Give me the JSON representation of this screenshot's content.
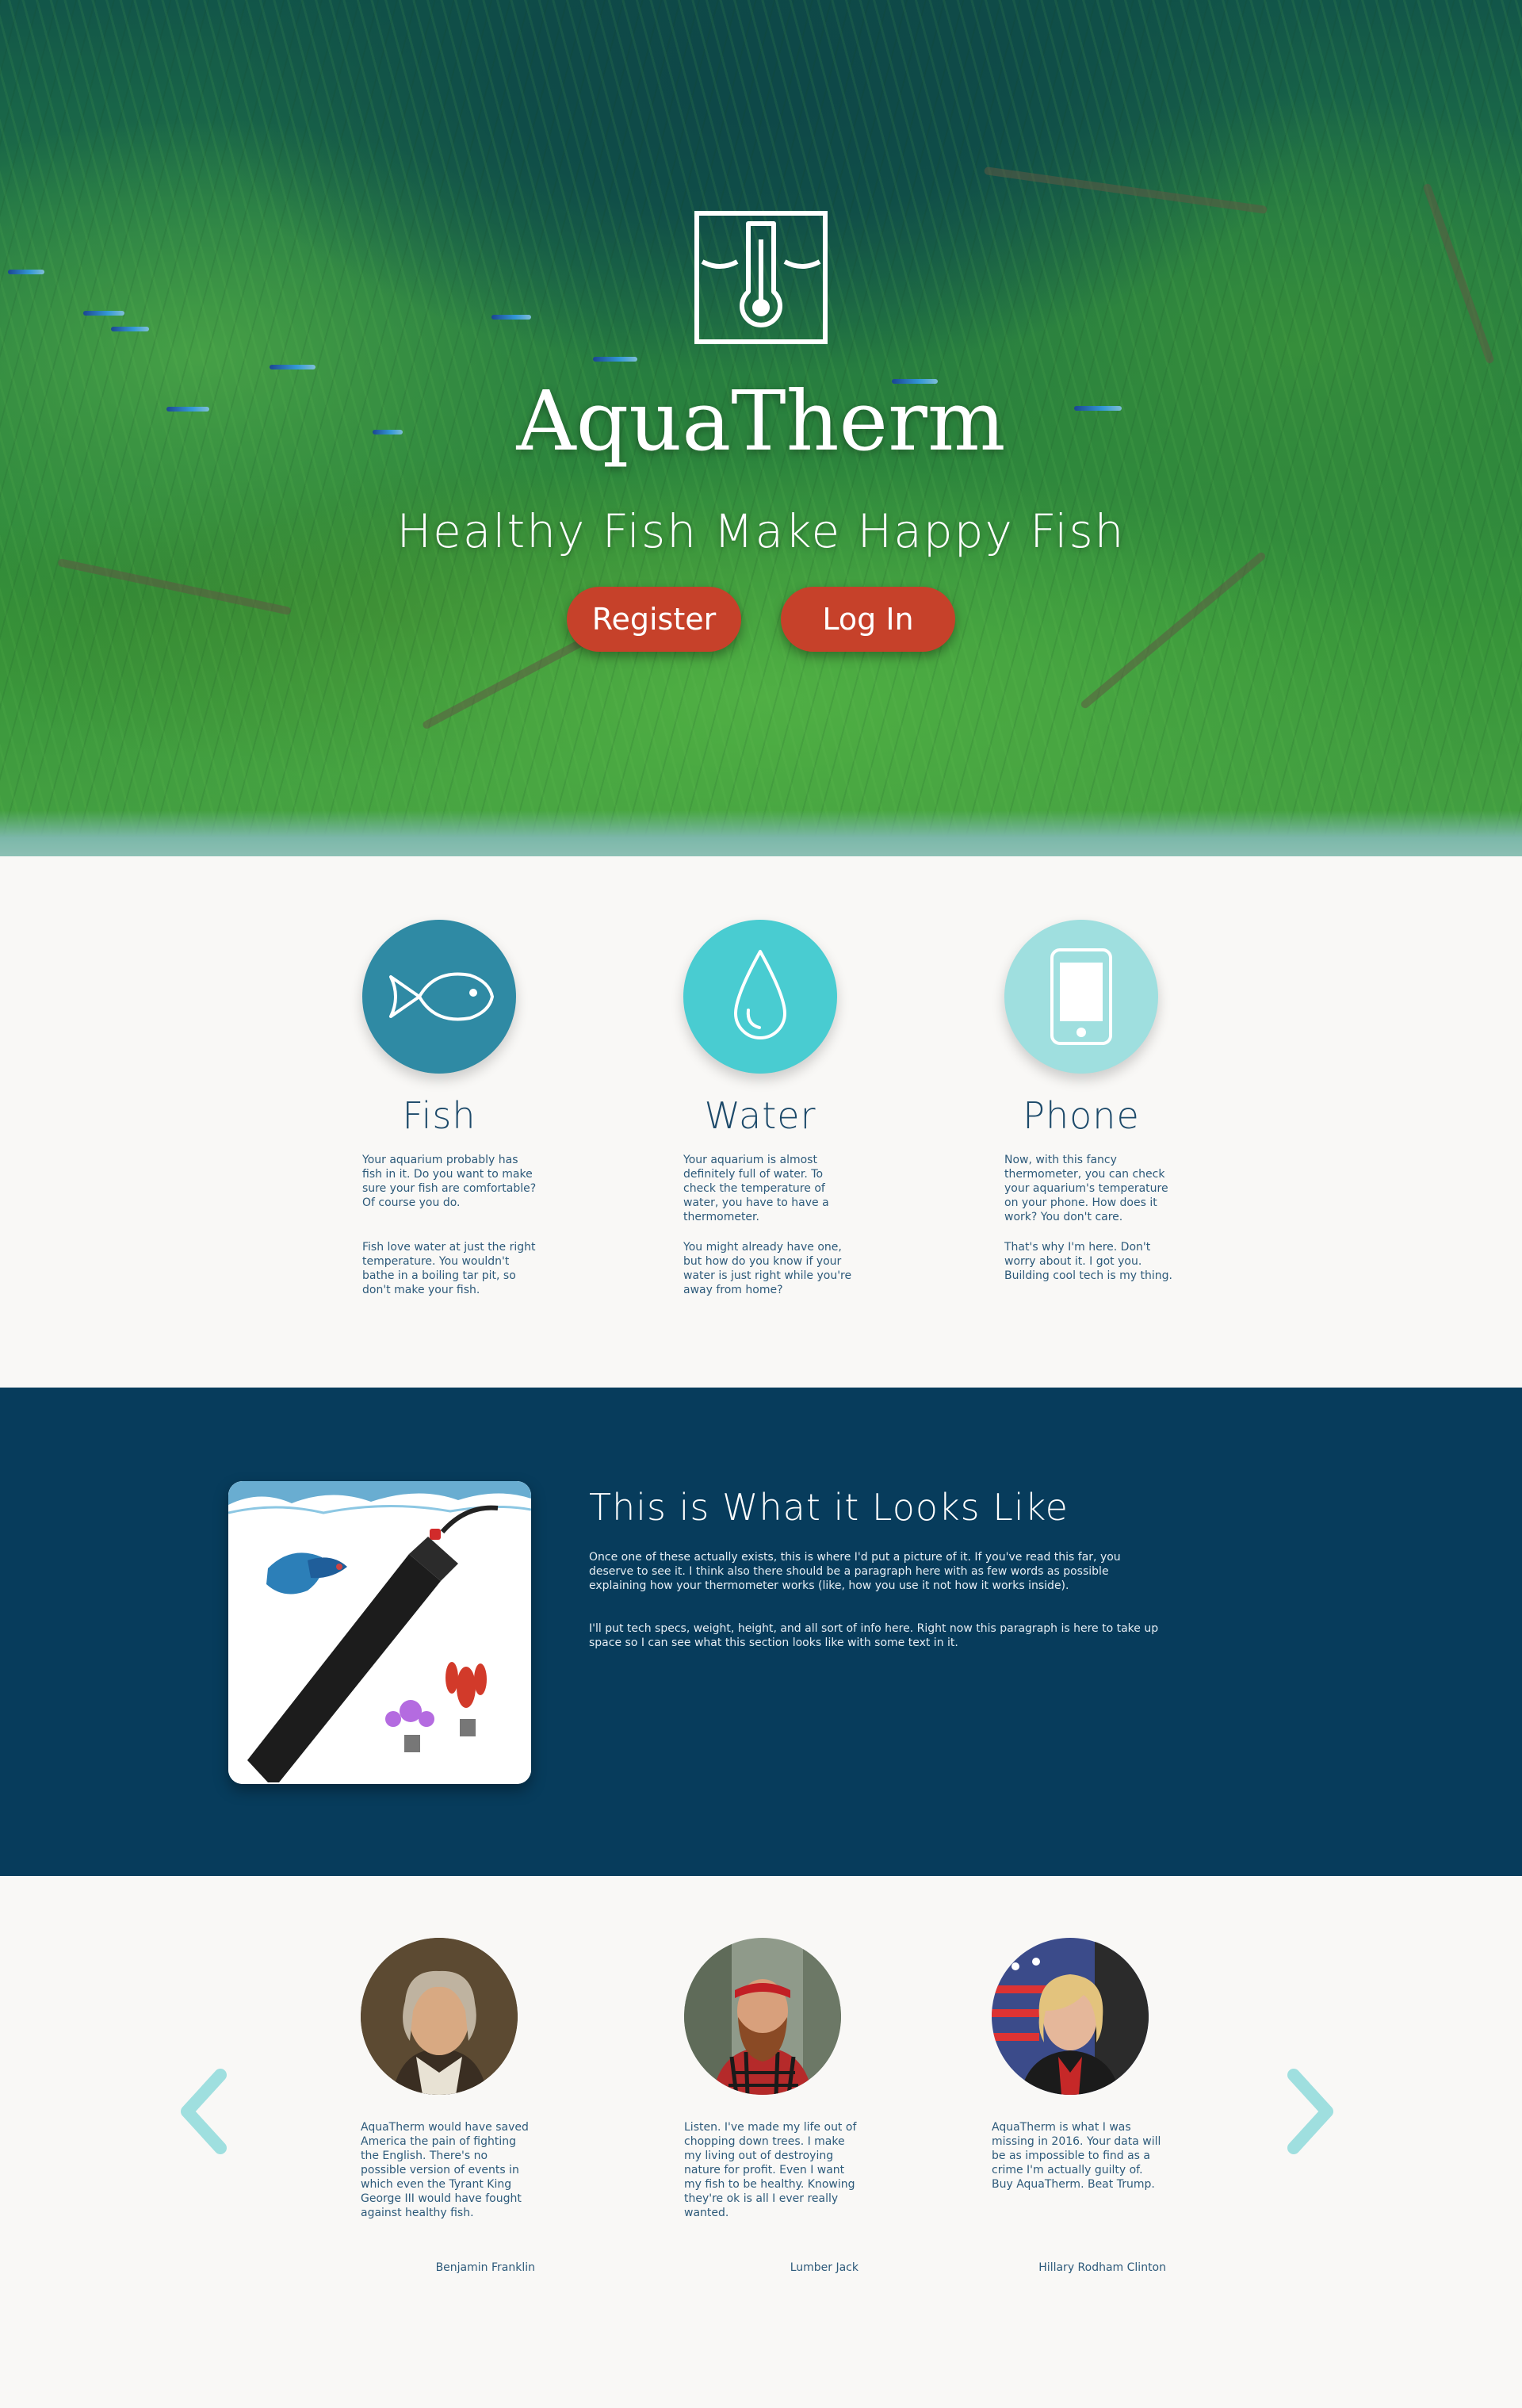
{
  "hero": {
    "brand": "AquaTherm",
    "tagline": "Healthy Fish Make Happy Fish",
    "register_label": "Register",
    "login_label": "Log In",
    "logo_icon": "thermometer-water-icon",
    "button_color": "#c6412a"
  },
  "features": [
    {
      "icon": "fish-icon",
      "color": "#2f8aa4",
      "title": "Fish",
      "para1": "Your aquarium probably has fish in it. Do you want to make sure your fish are comfortable? Of course you do.",
      "para2": "Fish love water at just the right temperature. You wouldn't bathe in a boiling tar pit, so don't make your fish."
    },
    {
      "icon": "water-drop-icon",
      "color": "#49ccd1",
      "title": "Water",
      "para1": "Your aquarium is almost definitely full of water. To check the temperature of water, you have to have a thermometer.",
      "para2": "You might already have one, but how do you know if your water is just right while you're away from home?"
    },
    {
      "icon": "phone-icon",
      "color": "#9fdfdf",
      "title": "Phone",
      "para1": "Now, with this fancy thermometer, you can check your aquarium's temperature on your phone. How does it work? You don't care.",
      "para2": "That's why I'm here. Don't worry about it. I got you. Building cool tech is my thing."
    }
  ],
  "product": {
    "title": "This is What it Looks Like",
    "para1": "Once one of these actually exists, this is where I'd put a picture of it. If you've read this far, you deserve to see it. I think also there should be a paragraph here with as few words as possible explaining how your thermometer works (like, how you use it not how it works inside).",
    "para2": "I'll put tech specs, weight, height, and all sort of info here. Right now this paragraph is here to take up space so I can see what this section looks like with some text in it.",
    "background": "#073c5c"
  },
  "testimonials": [
    {
      "quote": "AquaTherm would have saved America the pain of fighting the English. There's no possible version of events in which even the Tyrant King George III would have fought against healthy fish.",
      "author": "Benjamin Franklin"
    },
    {
      "quote": "Listen. I've made my life out of chopping down trees. I make my living out of destroying nature for profit. Even I want my fish to be healthy. Knowing they're ok is all I ever really wanted.",
      "author": "Lumber Jack"
    },
    {
      "quote": "AquaTherm is what I was missing in 2016. Your data will be as impossible to find as a crime I'm actually guilty of. Buy AquaTherm. Beat Trump.",
      "author": "Hillary Rodham Clinton"
    }
  ],
  "carousel": {
    "prev_icon": "chevron-left-icon",
    "next_icon": "chevron-right-icon",
    "arrow_color": "#9fdfdf"
  }
}
